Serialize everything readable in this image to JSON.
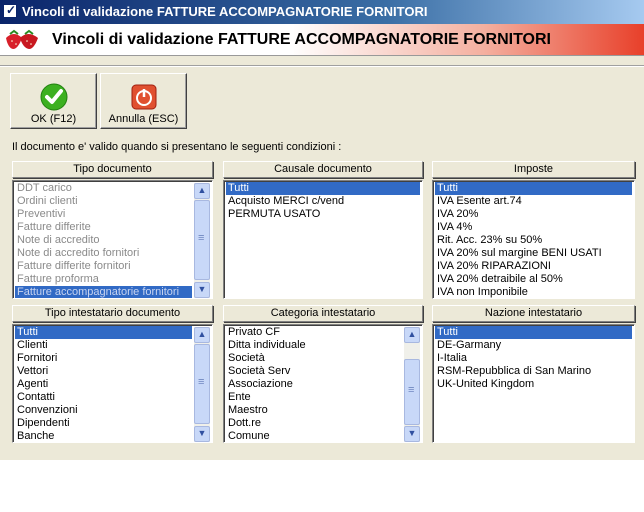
{
  "window": {
    "title": "Vincoli di validazione FATTURE ACCOMPAGNATORIE FORNITORI"
  },
  "header": {
    "title": "Vincoli di validazione FATTURE ACCOMPAGNATORIE FORNITORI"
  },
  "toolbar": {
    "ok_label": "OK (F12)",
    "cancel_label": "Annulla (ESC)"
  },
  "intro_text": "Il documento e' valido quando si presentano le seguenti condizioni :",
  "colors": {
    "selection": "#316ac5",
    "face": "#ece9d8",
    "ok_icon": "#3cb020",
    "cancel_icon": "#e05030"
  },
  "panels": {
    "tipo_documento": {
      "title": "Tipo documento",
      "items": [
        "DDT carico",
        "Ordini clienti",
        "Preventivi",
        "Fatture differite",
        "Note di accredito",
        "Note di accredito fornitori",
        "Fatture differite fornitori",
        "Fatture proforma",
        "Fatture accompagnatorie fornitori"
      ]
    },
    "causale_documento": {
      "title": "Causale documento",
      "items": [
        "Tutti",
        "Acquisto MERCI c/vend",
        "PERMUTA USATO"
      ]
    },
    "imposte": {
      "title": "Imposte",
      "items": [
        "Tutti",
        "IVA Esente art.74",
        "IVA 20%",
        "IVA 4%",
        "Rit. Acc. 23% su 50%",
        "IVA 20% sul margine BENI USATI",
        "IVA 20% RIPARAZIONI",
        "IVA 20% detraibile al 50%",
        "IVA non Imponibile"
      ]
    },
    "tipo_intestatario": {
      "title": "Tipo intestatario documento",
      "items": [
        "Tutti",
        "Clienti",
        "Fornitori",
        "Vettori",
        "Agenti",
        "Contatti",
        "Convenzioni",
        "Dipendenti",
        "Banche"
      ]
    },
    "categoria_intestatario": {
      "title": "Categoria intestatario",
      "items": [
        "Privato CF",
        "Ditta individuale",
        "Società",
        "Società Serv",
        "Associazione",
        "Ente",
        "Maestro",
        "Dott.re",
        "Comune"
      ]
    },
    "nazione_intestatario": {
      "title": "Nazione intestatario",
      "items": [
        "Tutti",
        "DE-Garmany",
        "I-Italia",
        "RSM-Repubblica di San Marino",
        "UK-United Kingdom"
      ]
    }
  }
}
